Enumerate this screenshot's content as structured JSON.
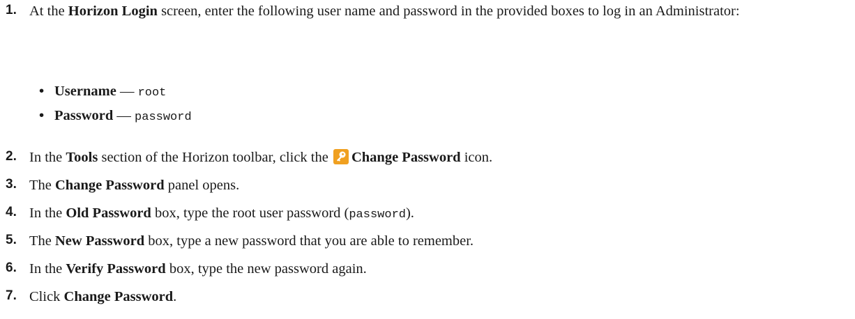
{
  "steps": [
    {
      "num": "1.",
      "pre": "At the ",
      "b1": "Horizon Login",
      "post": " screen, enter the following user name and password in the provided boxes to log in an Administrator:",
      "bullets": [
        {
          "dot": "•",
          "label": "Username",
          "sep": " — ",
          "value": "root"
        },
        {
          "dot": "•",
          "label": "Password",
          "sep": " — ",
          "value": "password"
        }
      ]
    },
    {
      "num": "2.",
      "pre": "In the ",
      "b1": "Tools",
      "mid": " section of the Horizon toolbar, click the ",
      "icon": "key-icon",
      "b2": "Change Password",
      "post": " icon."
    },
    {
      "num": "3.",
      "pre": "The ",
      "b1": "Change Password",
      "post": " panel opens."
    },
    {
      "num": "4.",
      "pre": "In the ",
      "b1": "Old Password",
      "mid": " box, type the root user password (",
      "code": "password",
      "post": ")."
    },
    {
      "num": "5.",
      "pre": "The ",
      "b1": "New Password",
      "post": " box, type a new password that you are able to remember."
    },
    {
      "num": "6.",
      "pre": "In the ",
      "b1": "Verify Password",
      "post": " box, type the new password again."
    },
    {
      "num": "7.",
      "pre": "Click ",
      "b1": "Change Password",
      "post": "."
    }
  ],
  "colors": {
    "text": "#1a1a1a",
    "icon_bg": "#f0a020",
    "icon_key": "#ffffff"
  }
}
